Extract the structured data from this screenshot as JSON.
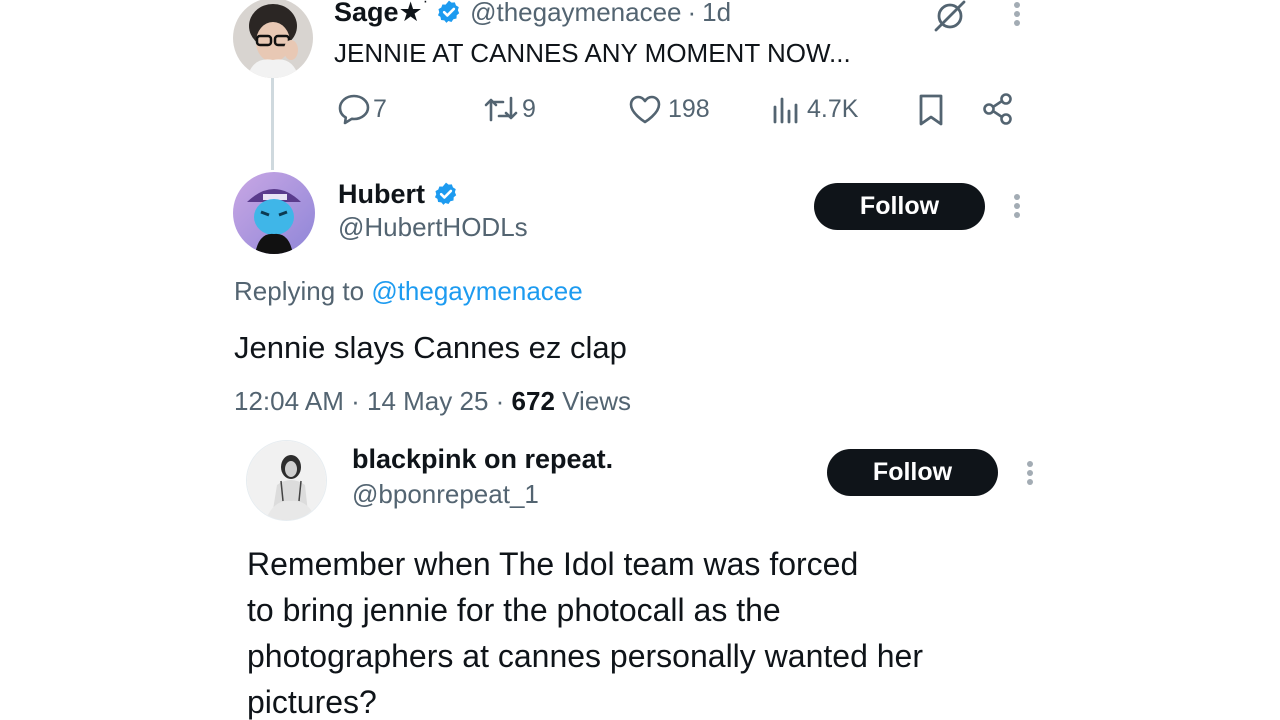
{
  "tweet1": {
    "name": "Sage★",
    "sup": "·",
    "handle": "@thegaymenacee",
    "separator": "·",
    "time": "1d",
    "text": "JENNIE AT CANNES ANY MOMENT NOW...",
    "actions": {
      "replies": "7",
      "retweets": "9",
      "likes": "198",
      "views": "4.7K"
    },
    "icons": [
      "grok-icon",
      "more-icon",
      "reply-icon",
      "retweet-icon",
      "like-icon",
      "views-icon",
      "bookmark-icon",
      "share-icon"
    ]
  },
  "tweet2": {
    "name": "Hubert",
    "handle": "@HubertHODLs",
    "follow_label": "Follow",
    "replying_prefix": "Replying to",
    "replying_handle": "@thegaymenacee",
    "text": "Jennie slays Cannes ez clap",
    "time": "12:04 AM",
    "sep1": "·",
    "date": "14 May 25",
    "sep2": "·",
    "views_count": "672",
    "views_label": "Views"
  },
  "quote": {
    "name": "blackpink on repeat.",
    "handle": "@bponrepeat_1",
    "follow_label": "Follow",
    "text_lines": [
      "Remember when The Idol team was forced",
      "to bring jennie for the photocall as the",
      "photographers at cannes personally wanted her",
      "pictures?"
    ]
  },
  "colors": {
    "text": "#0f1419",
    "secondary": "#536471",
    "link": "#1d9bf0",
    "verified": "#1d9bf0",
    "follow_bg": "#0f1419"
  }
}
